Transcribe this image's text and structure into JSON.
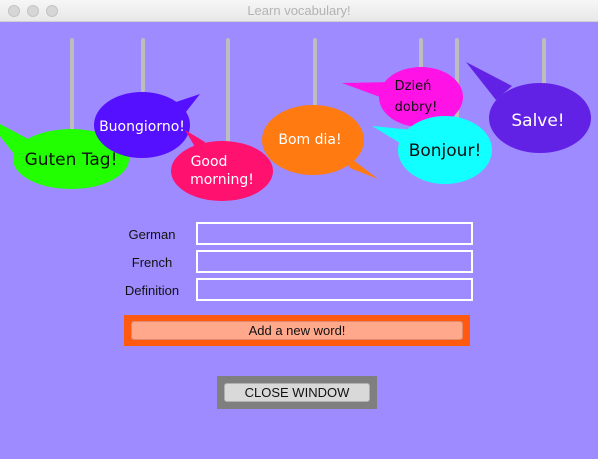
{
  "window": {
    "title": "Learn vocabulary!",
    "background_color": "#9e8bff"
  },
  "greetings": [
    {
      "text": "Guten Tag!",
      "color": "#21ff00",
      "text_color": "#111111"
    },
    {
      "text": "Buongiorno!",
      "color": "#5510ff",
      "text_color": "#ffffff"
    },
    {
      "text_line1": "Good",
      "text_line2": "morning!",
      "color": "#ff1170",
      "text_color": "#ffffff"
    },
    {
      "text": "Bom dia!",
      "color": "#ff7a10",
      "text_color": "#ffffff"
    },
    {
      "text_line1": "Dzień",
      "text_line2": "dobry!",
      "color": "#ff12e6",
      "text_color": "#111111"
    },
    {
      "text": "Bonjour!",
      "color": "#12ffff",
      "text_color": "#111111"
    },
    {
      "text": "Salve!",
      "color": "#6222e6",
      "text_color": "#ffffff"
    }
  ],
  "form": {
    "german_label": "German",
    "french_label": "French",
    "definition_label": "Definition",
    "german_value": "",
    "french_value": "",
    "definition_value": ""
  },
  "buttons": {
    "add_label": "Add a new word!",
    "add_frame_color": "#ff5a0f",
    "add_button_color": "#ffa88c",
    "close_label": "CLOSE WINDOW"
  }
}
